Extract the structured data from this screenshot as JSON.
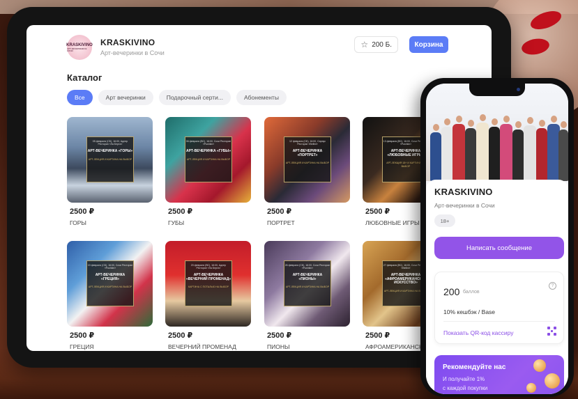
{
  "tablet": {
    "brand": {
      "logo_text": "KRASKIVINO",
      "logo_sub": "АРТ-ВЕЧЕРИНКИ В СОЧИ",
      "name": "KRASKIVINO",
      "subtitle": "Арт-вечеринки в Сочи"
    },
    "header": {
      "points_label": "200 Б.",
      "cart_label": "Корзина",
      "star_icon": "star-icon"
    },
    "catalog_title": "Каталог",
    "filters": [
      {
        "label": "Все",
        "active": true
      },
      {
        "label": "Арт вечеринки",
        "active": false
      },
      {
        "label": "Подарочный серти...",
        "active": false
      },
      {
        "label": "Абонементы",
        "active": false
      }
    ],
    "products": [
      {
        "price": "2500 ₽",
        "name": "ГОРЫ",
        "poster": {
          "info": "05 февраля (СБ), 16:00, Адлер Ресторан «Ла Берта»",
          "title": "АРТ-ВЕЧЕРИНКА «ГОРЫ»",
          "footer": "АРТ-ЛЕКЦИЯ И КАРТИНА НА ВЫБОР"
        }
      },
      {
        "price": "2500 ₽",
        "name": "ГУБЫ",
        "poster": {
          "info": "06 февраля (ВС), 16:00, Сочи Ресторан «Pushkin»",
          "title": "АРТ-ВЕЧЕРИНКА «ГУБЫ»",
          "footer": "АРТ-ЛЕКЦИЯ И КАРТИНА НА ВЫБОР"
        }
      },
      {
        "price": "2500 ₽",
        "name": "ПОРТРЕТ",
        "poster": {
          "info": "12 февраля (СБ), 16:00, Сириус Ресторан «Bellini»",
          "title": "АРТ-ВЕЧЕРИНКА «ПОРТРЕТ»",
          "footer": "АРТ-ЛЕКЦИЯ И КАРТИНА НА ВЫБОР"
        }
      },
      {
        "price": "2500 ₽",
        "name": "ЛЮБОВНЫЕ ИГРЫ",
        "poster": {
          "info": "13 февраля (ВС), 16:00, Сочи Ресторан «Pushkin»",
          "title": "АРТ-ВЕЧЕРИНКА «ЛЮБОВНЫЕ ИГРЫ»",
          "footer": "АРТ-ЛЕКЦИЯ 18+ И КАРТИНА НА ВЫБОР"
        }
      },
      {
        "price": "2500 ₽",
        "name": "ГРЕЦИЯ",
        "poster": {
          "info": "19 февраля (СБ), 16:00, Сочи Ресторан «Pushkin»",
          "title": "АРТ-ВЕЧЕРИНКА «ГРЕЦИЯ»",
          "footer": "АРТ-ЛЕКЦИЯ И КАРТИНА НА ВЫБОР"
        }
      },
      {
        "price": "2500 ₽",
        "name": "ВЕЧЕРНИЙ ПРОМЕНАД",
        "poster": {
          "info": "20 февраля (ВС), 16:00, Адлер Ресторан «Ла Берта»",
          "title": "АРТ-ВЕЧЕРИНКА «ВЕЧЕРНИЙ ПРОМЕНАД»",
          "footer": "КАРТИНА С ПОТАЛЬЮ НА ВЫБОР"
        }
      },
      {
        "price": "2500 ₽",
        "name": "ПИОНЫ",
        "poster": {
          "info": "26 февраля (СБ), 16:00, Сочи Ресторан «Pushkin»",
          "title": "АРТ-ВЕЧЕРИНКА «ПИОНЫ»",
          "footer": "АРТ-ЛЕКЦИЯ И КАРТИНА НА ВЫБОР"
        }
      },
      {
        "price": "2500 ₽",
        "name": "АФРОАМЕРИКАНСКОЕ ИСКУССТВО",
        "poster": {
          "info": "27 февраля (ВС), 16:00, Сочи Ресторан «Bellini»",
          "title": "АРТ-ВЕЧЕРИНКА «АФРОАМЕРИКАНСКОЕ ИСКУССТВО»",
          "footer": "АРТ-ЛЕКЦИЯ И КАРТИНА НА ВЫБОР"
        }
      }
    ]
  },
  "phone": {
    "title": "KRASKIVINO",
    "subtitle": "Арт-вечеринки в Сочи",
    "age": "18+",
    "message_button": "Написать сообщение",
    "points": {
      "value": "200",
      "unit": "баллов",
      "help": "?",
      "cashback": "10% кешбэк / Base",
      "qr_link": "Показать QR-код кассиру"
    },
    "promo": {
      "title": "Рекомендуйте нас",
      "line1": "И получайте 1%",
      "line2": "с каждой покупки"
    }
  },
  "colors": {
    "accent_blue": "#5b7cf6",
    "accent_purple": "#9254e8",
    "link_purple": "#8b4fe6"
  }
}
